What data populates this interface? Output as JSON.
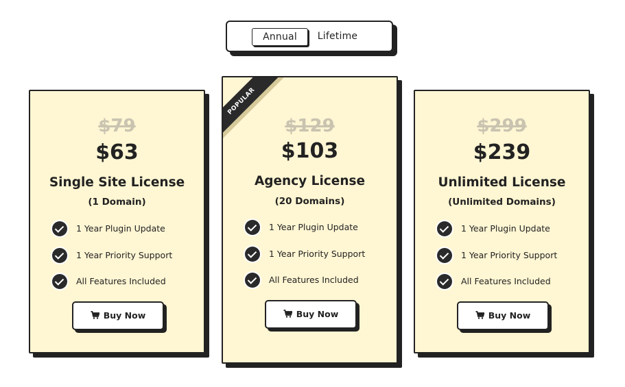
{
  "billing_toggle": {
    "options": [
      "Annual",
      "Lifetime"
    ],
    "selected": "Annual"
  },
  "plans": [
    {
      "old_price": "$79",
      "price": "$63",
      "title": "Single Site License",
      "subtitle": "(1 Domain)",
      "features": [
        "1 Year Plugin Update",
        "1 Year Priority Support",
        "All Features Included"
      ],
      "button": "Buy Now"
    },
    {
      "badge": "POPULAR",
      "old_price": "$129",
      "price": "$103",
      "title": "Agency License",
      "subtitle": "(20 Domains)",
      "features": [
        "1 Year Plugin Update",
        "1 Year Priority Support",
        "All Features Included"
      ],
      "button": "Buy Now"
    },
    {
      "old_price": "$299",
      "price": "$239",
      "title": "Unlimited License",
      "subtitle": "(Unlimited Domains)",
      "features": [
        "1 Year Plugin Update",
        "1 Year Priority Support",
        "All Features Included"
      ],
      "button": "Buy Now"
    }
  ],
  "icons": {
    "feature": "check-circle-icon",
    "button": "cart-icon"
  },
  "colors": {
    "card_background": "#fff6d3",
    "border": "#222222",
    "old_price": "#c9c3b0",
    "ribbon": "#2a2a2a",
    "ribbon_shadow": "#d6c99a"
  }
}
